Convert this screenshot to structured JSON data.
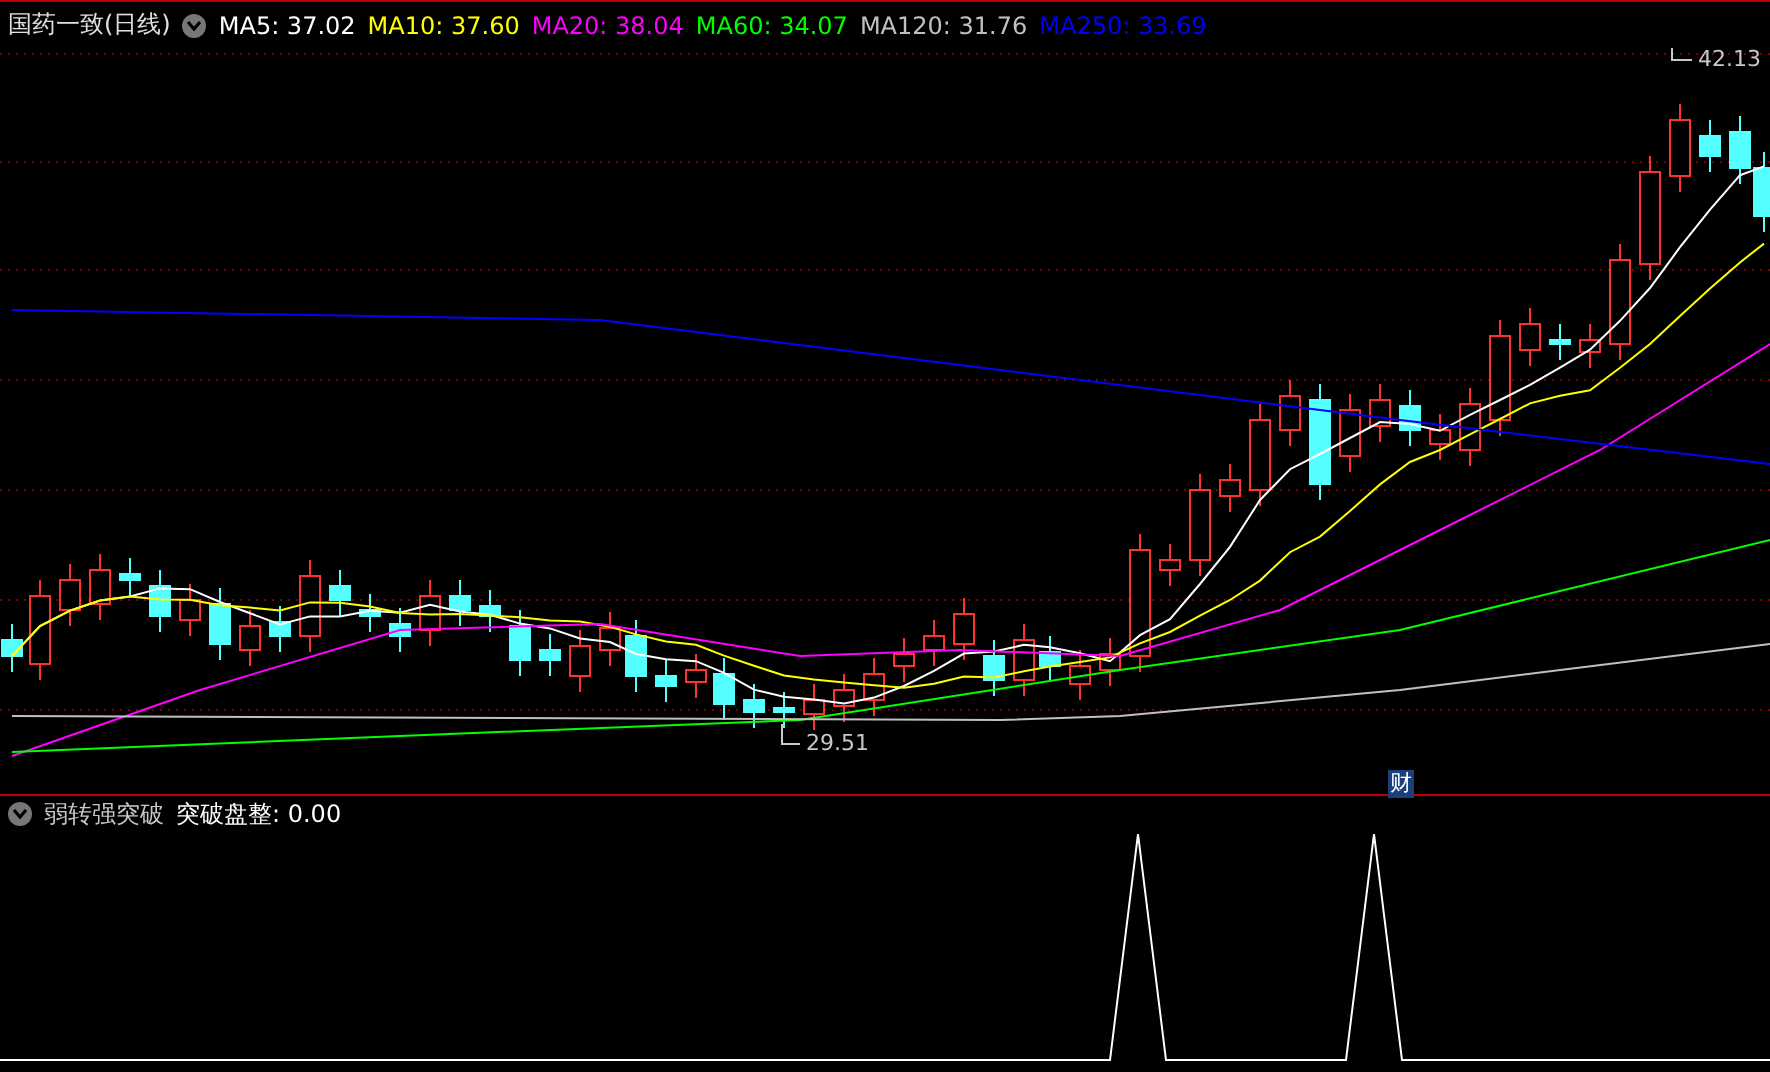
{
  "header": {
    "title": "国药一致(日线)",
    "averages": [
      {
        "text": "MA5: 37.02",
        "color": "#ffffff"
      },
      {
        "text": "MA10: 37.60",
        "color": "#ffff00"
      },
      {
        "text": "MA20: 38.04",
        "color": "#ff00ff"
      },
      {
        "text": "MA60: 34.07",
        "color": "#00ff00"
      },
      {
        "text": "MA120: 31.76",
        "color": "#c0c0c0"
      },
      {
        "text": "MA250: 33.69",
        "color": "#0000ff"
      }
    ]
  },
  "main_chart": {
    "high_label": "42.13",
    "low_label": "29.51",
    "badge": "财"
  },
  "indicator": {
    "name": "弱转强突破",
    "reading": "突破盘整: 0.00"
  }
}
